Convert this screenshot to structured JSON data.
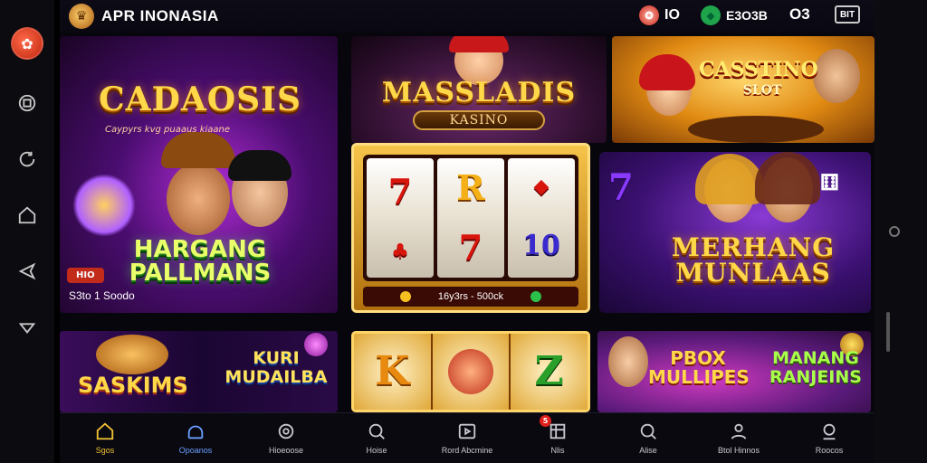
{
  "app": {
    "title": "APR INONASIA"
  },
  "topbar": {
    "stat1": "IO",
    "stat2": "E3O3B",
    "stat3": "O3",
    "stat4": "BIT"
  },
  "cards": {
    "card1": {
      "title": "CADAOSIS",
      "subtitle": "Caypyrs kvg puaaus kiaane",
      "name": "HARGANG PALLMANS",
      "badge": "HIO",
      "price": "S3to 1 Soodo"
    },
    "card2": {
      "title": "MASSLADIS",
      "plate": "KASINO"
    },
    "card3": {
      "title": "CASSTINO",
      "subtitle": "SLOT"
    },
    "card4": {
      "reels": [
        [
          "7",
          "7"
        ],
        [
          "R",
          "7"
        ],
        [
          "10"
        ]
      ],
      "footer": "16y3rs - 500ck"
    },
    "card5": {
      "title": "MERHANG MUNLAAS"
    },
    "card6": {
      "title1": "SASKIMS",
      "title2": "KURI MUDAILBA"
    },
    "card7": {
      "symbols": [
        "K",
        "Z"
      ]
    },
    "card8": {
      "title1": "PBOX MULLIPES",
      "title2": "MANANG RANJEINS"
    }
  },
  "nav": {
    "items": [
      {
        "label": "Sgos",
        "icon": "home-icon"
      },
      {
        "label": "Opoanos",
        "icon": "promo-icon"
      },
      {
        "label": "Hioeoose",
        "icon": "chip-icon"
      },
      {
        "label": "Hoise",
        "icon": "search-icon"
      },
      {
        "label": "Rord Abcmine",
        "icon": "video-icon"
      },
      {
        "label": "Nlis",
        "icon": "grid-icon",
        "badge": "5"
      },
      {
        "label": "Alise",
        "icon": "search2-icon"
      },
      {
        "label": "Btol Hinnos",
        "icon": "user-icon"
      },
      {
        "label": "Roocos",
        "icon": "profile-icon"
      }
    ]
  },
  "colors": {
    "accent": "#f1c232",
    "background": "#07060c"
  }
}
